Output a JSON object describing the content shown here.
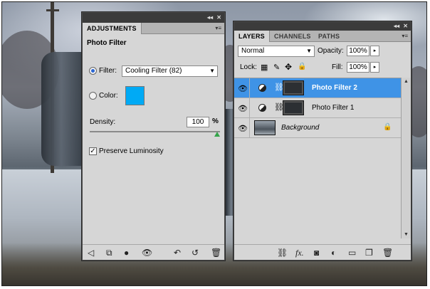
{
  "adjustments": {
    "tab_label": "ADJUSTMENTS",
    "heading": "Photo Filter",
    "filter_label": "Filter:",
    "filter_value": "Cooling Filter (82)",
    "color_label": "Color:",
    "color_swatch": "#00AAF5",
    "density_label": "Density:",
    "density_value": "100",
    "density_unit": "%",
    "density_level": 1.0,
    "preserve_label": "Preserve Luminosity",
    "preserve_checked": true
  },
  "layers_panel": {
    "tabs": [
      "LAYERS",
      "CHANNELS",
      "PATHS"
    ],
    "blend_mode": "Normal",
    "opacity_label": "Opacity:",
    "opacity_value": "100%",
    "lock_label": "Lock:",
    "fill_label": "Fill:",
    "fill_value": "100%",
    "layers": [
      {
        "name": "Photo Filter 2",
        "selected": true,
        "type": "adjustment"
      },
      {
        "name": "Photo Filter 1",
        "selected": false,
        "type": "adjustment"
      },
      {
        "name": "Background",
        "selected": false,
        "type": "image",
        "locked": true
      }
    ]
  },
  "colors": {
    "selection": "#3F93E6",
    "panel_bg": "#D6D6D6",
    "swatch": "#00AAF5"
  }
}
